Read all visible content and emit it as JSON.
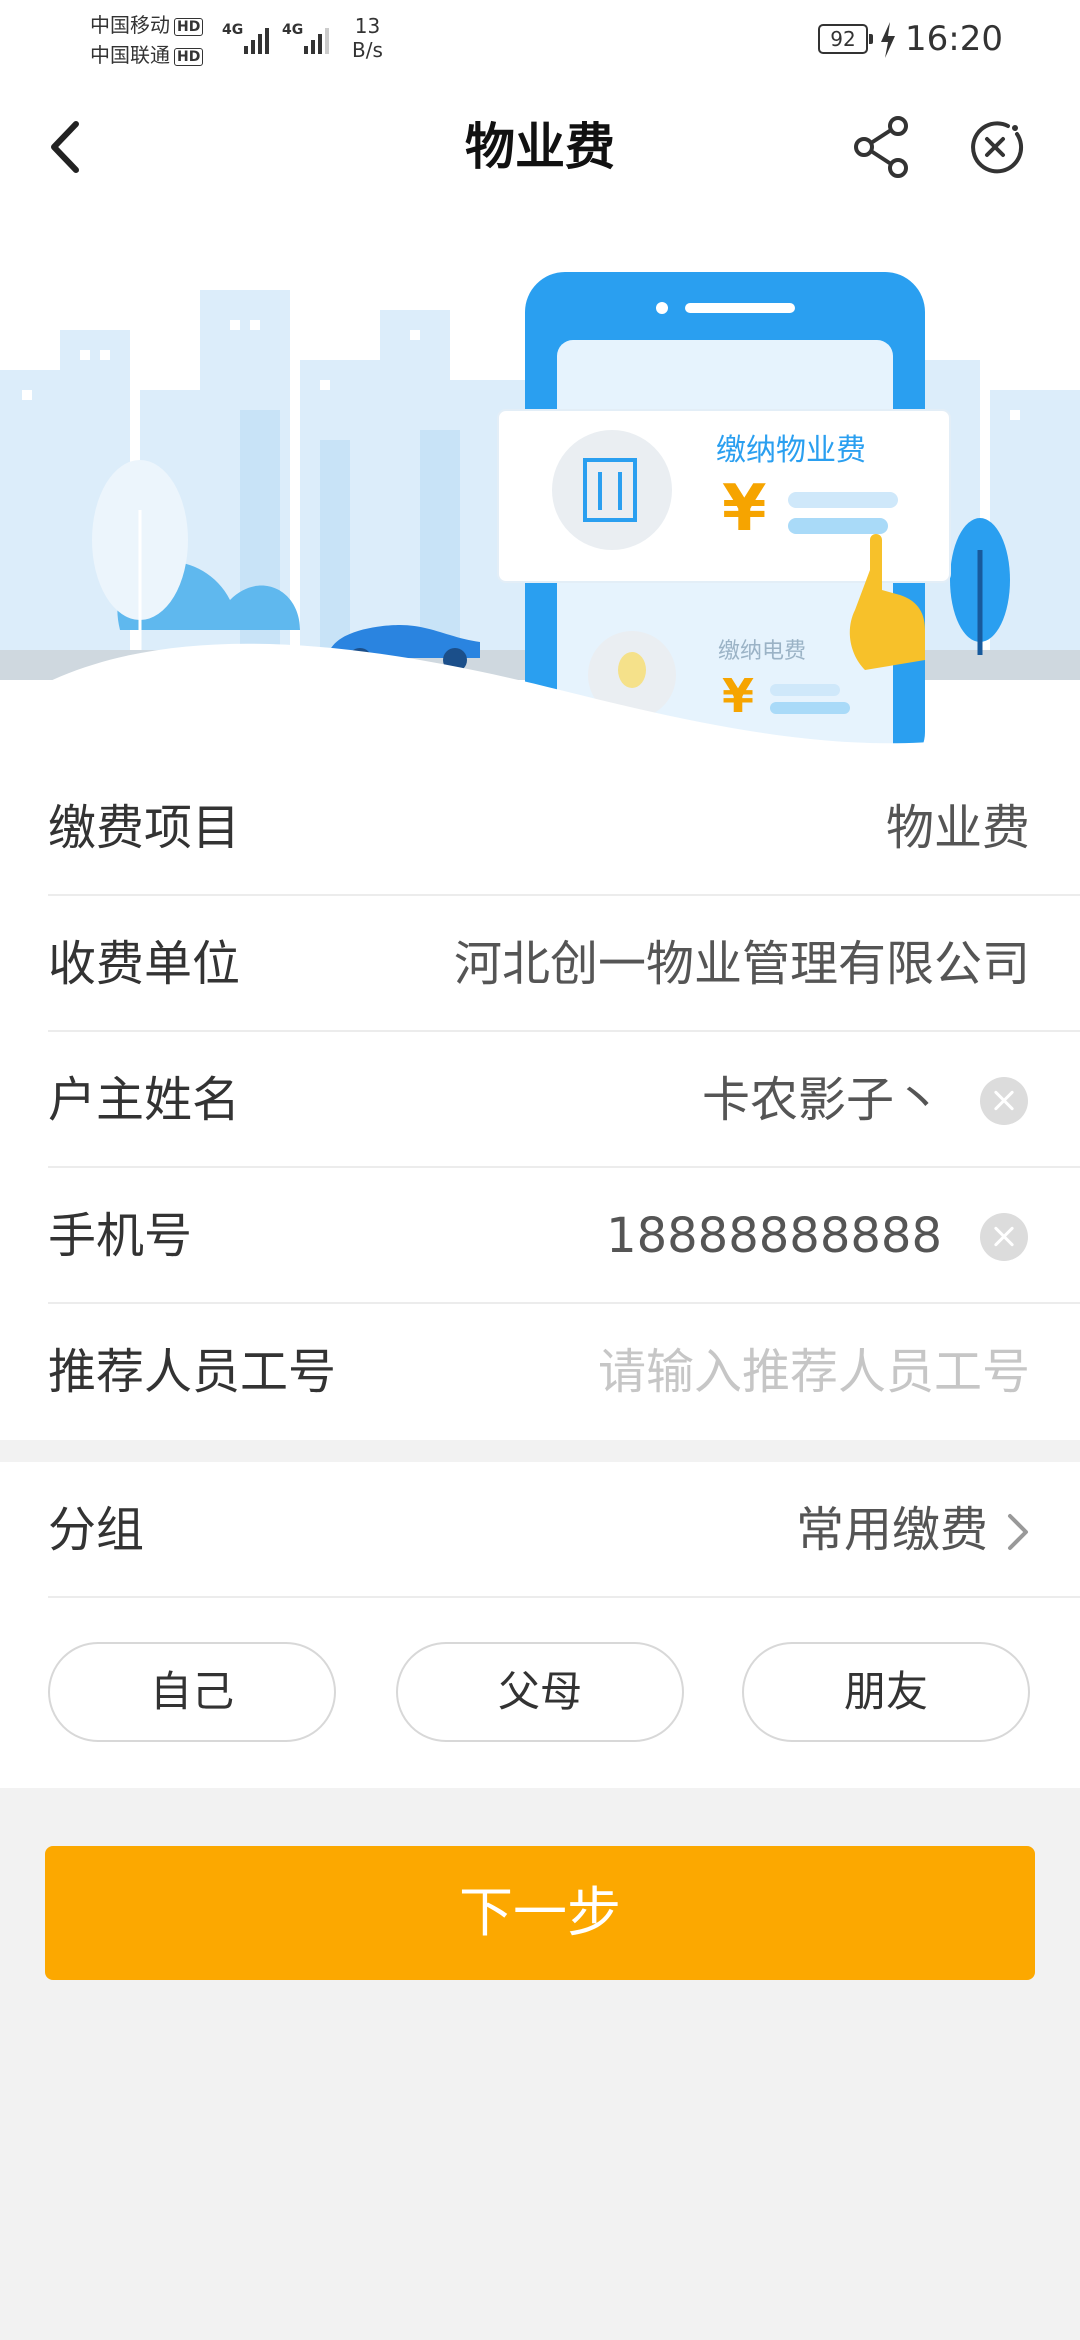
{
  "status_bar": {
    "carrier1": "中国移动",
    "carrier2": "中国联通",
    "hd_badge": "HD",
    "net_type": "4G",
    "net_speed_value": "13",
    "net_speed_unit": "B/s",
    "battery": "92",
    "time": "16:20"
  },
  "nav": {
    "title": "物业费",
    "back_icon": "chevron-left",
    "share_icon": "share",
    "close_icon": "close-circle"
  },
  "banner": {
    "card_main_title": "缴纳物业费",
    "card_secondary_title": "缴纳电费",
    "currency": "¥",
    "colors": {
      "accent_blue": "#2a9ff0",
      "yuan_orange": "#f6a400",
      "sky": "#d9eefb"
    }
  },
  "form": {
    "rows": [
      {
        "label": "缴费项目",
        "value": "物业费"
      },
      {
        "label": "收费单位",
        "value": "河北创一物业管理有限公司"
      },
      {
        "label": "户主姓名",
        "value": "卡农影子丶"
      },
      {
        "label": "手机号",
        "value": "18888888888"
      },
      {
        "label": "推荐人员工号",
        "placeholder": "请输入推荐人员工号"
      }
    ]
  },
  "group": {
    "label": "分组",
    "value": "常用缴费",
    "chips": [
      "自己",
      "父母",
      "朋友"
    ]
  },
  "actions": {
    "next_label": "下一步",
    "next_color": "#fca800"
  }
}
